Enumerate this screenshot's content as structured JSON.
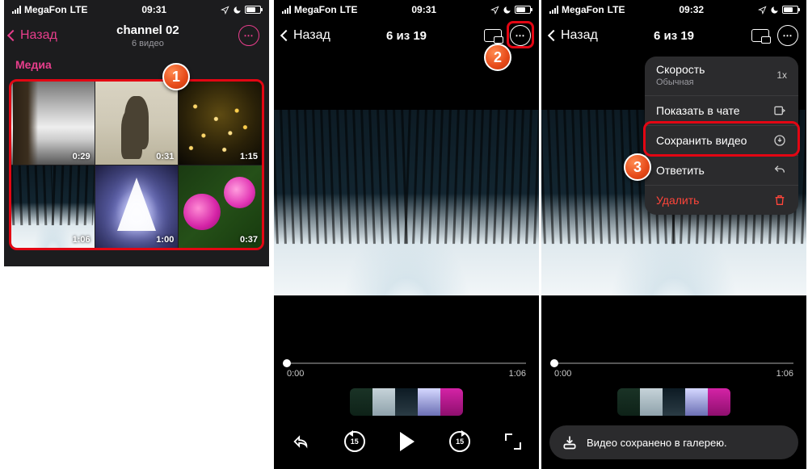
{
  "status": {
    "carrier": "MegaFon",
    "network": "LTE",
    "time1": "09:31",
    "time2": "09:31",
    "time3": "09:32"
  },
  "screen1": {
    "back": "Назад",
    "title": "channel 02",
    "subtitle": "6 видео",
    "tab_media": "Медиа",
    "thumbs": [
      "0:29",
      "0:31",
      "1:15",
      "1:06",
      "1:00",
      "0:37"
    ]
  },
  "screen2": {
    "back": "Назад",
    "counter": "6 из 19",
    "time_start": "0:00",
    "time_end": "1:06",
    "skip": "15"
  },
  "screen3": {
    "back": "Назад",
    "counter": "6 из 19",
    "time_start": "0:00",
    "time_end": "1:06",
    "menu": {
      "speed": "Скорость",
      "speed_sub": "Обычная",
      "speed_badge": "1x",
      "show_chat": "Показать в чате",
      "save_video": "Сохранить видео",
      "reply": "Ответить",
      "delete": "Удалить"
    },
    "toast": "Видео сохранено в галерею."
  },
  "badges": {
    "b1": "1",
    "b2": "2",
    "b3": "3"
  }
}
